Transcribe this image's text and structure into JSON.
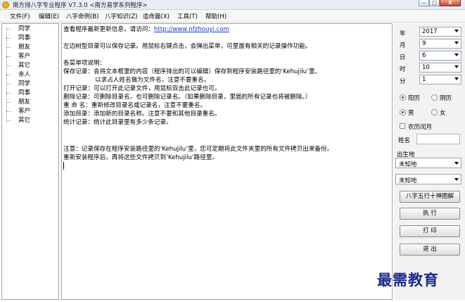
{
  "window": {
    "title": "南方排八字专业程序 V7.3.0  <南方易学系列程序>",
    "min_label": "—",
    "max_label": "□",
    "close_label": "X"
  },
  "menu": [
    "文件(F)",
    "编辑(E)",
    "八字命例(B)",
    "八字知识(Z)",
    "造命篇(X)",
    "工具(T)",
    "帮助(H)"
  ],
  "tree": [
    "同学",
    "同事",
    "朋友",
    "客户",
    "其它",
    "亲人",
    "同学",
    "同事",
    "朋友",
    "客户",
    "其它"
  ],
  "notes": {
    "update_prefix": "查看程序最新更新信息，请访问：",
    "update_link": "http://www.nfzhouyi.com",
    "tip": "左边树型目录可以保存记录。用鼠标右键点击，会弹出菜单，可里面有相关的记录操作功能。",
    "menu_heading": "各菜单项说明：",
    "save_line1": "保存记录：会将文本框里的内容（程序排出的可以编辑）保存到程序安装路径里的‘Kehujilu’里。",
    "save_line2": "以求占人姓名做为文件名，注意不要重名。",
    "open_line": "打开记录：可以打开此记录文件，用鼠标双击此记录也可。",
    "delete_line": "删除记录：可删除目录名，也可删除记录名。（如果删除目录，里面的所有记录也将被删除。）",
    "rename_line": "重 命 名：重新修改目录名或记录名，注意不要重名。",
    "add_line": "添加目录：添加新的目录名称。注意不要和其他目录重名。",
    "stats_line": "统计记录：统计此目录里有多少条记录。",
    "note_line1": "注意：记录保存在程序安装路径里的‘Kehujilu’里，您可定期将此文件夹里的所有文件拷贝出来备份。",
    "note_line2": "重新安装程序后，再将这些文件拷贝到‘Kehujilu’路径里。"
  },
  "side": {
    "year_label": "年",
    "year_value": "2017",
    "month_label": "月",
    "month_value": "9",
    "day_label": "日",
    "day_value": "6",
    "hour_label": "时",
    "hour_value": "10",
    "minute_label": "分",
    "minute_value": "1",
    "solar_label": "阳历",
    "lunar_label": "阴历",
    "male_label": "男",
    "female_label": "女",
    "leap_label": "农历闰月",
    "name_label": "姓名",
    "birthplace_label": "出生地",
    "place1_value": "未知地",
    "place2_value": "未知地",
    "chart_button": "八字五行十神图解",
    "run_button": "执 行",
    "print_button": "打 印",
    "exit_button": "退 出"
  },
  "watermark": "最需教育"
}
